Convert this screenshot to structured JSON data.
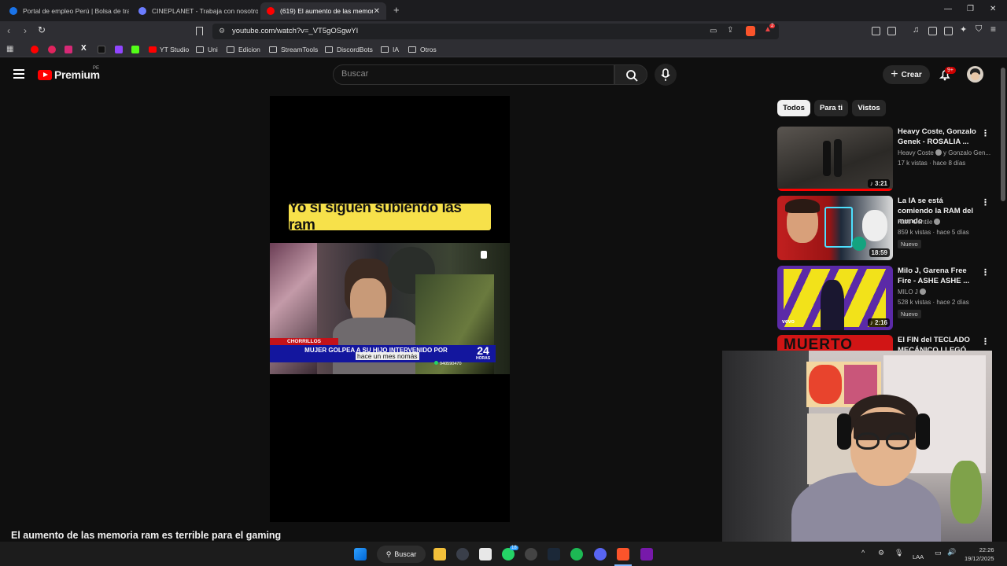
{
  "browser": {
    "tabs": [
      {
        "label": "Portal de empleo Perú | Bolsa de trab",
        "favicon_color": "#1a73e8"
      },
      {
        "label": "CINEPLANET - Trabaja con nosotros",
        "favicon_color": "#6b7cff"
      },
      {
        "label": "(619) El aumento de las memoria",
        "favicon_color": "#ff0000"
      }
    ],
    "new_tab_label": "+",
    "url": "youtube.com/watch?v=_VT5gOSgwYI",
    "shield_badge": "2",
    "bookmarks": [
      {
        "label": "YT Studio",
        "type": "link"
      },
      {
        "label": "Uni",
        "type": "folder"
      },
      {
        "label": "Edicion",
        "type": "folder"
      },
      {
        "label": "StreamTools",
        "type": "folder"
      },
      {
        "label": "DiscordBots",
        "type": "folder"
      },
      {
        "label": "IA",
        "type": "folder"
      },
      {
        "label": "Otros",
        "type": "folder"
      }
    ]
  },
  "youtube": {
    "logo_text": "Premium",
    "country": "PE",
    "search_placeholder": "Buscar",
    "create_label": "Crear",
    "notification_badge": "9+",
    "video": {
      "caption": "Yo si siguen subiendo las ram",
      "news_location": "CHORRILLOS",
      "news_headline": "MUJER GOLPEA A SU HIJO INTERVENIDO POR",
      "news_logo_top": "24",
      "news_logo_bottom": "HORAS",
      "news_phone": "940590470",
      "tooltip": "hace un mes nomás",
      "title": "El aumento de las memoria ram es terrible para el gaming"
    },
    "chips": [
      "Todos",
      "Para ti",
      "Vistos"
    ],
    "recommendations": [
      {
        "title": "Heavy Coste, Gonzalo Genek - ROSALIA ...",
        "channel": "Heavy Coste",
        "channel_extra": "y Gonzalo Gen...",
        "meta": "17 k vistas · hace 8 días",
        "duration": "3:21",
        "music": true,
        "new": "",
        "thumb_colors": [
          "#4a4642",
          "#2a2826"
        ]
      },
      {
        "title": "La IA se está comiendo la RAM del mundo",
        "channel": "Nate Gentile",
        "channel_extra": "",
        "meta": "859 k vistas · hace 5 días",
        "duration": "18:59",
        "music": false,
        "new": "Nuevo",
        "thumb_colors": [
          "#b21a1a",
          "#2aa7b8"
        ]
      },
      {
        "title": "Milo J, Garena Free Fire - ASHE ASHE ...",
        "channel": "MILO J",
        "channel_extra": "",
        "meta": "528 k vistas · hace 2 días",
        "duration": "2:16",
        "music": true,
        "new": "Nuevo",
        "thumb_colors": [
          "#f2e21a",
          "#5b2aa7"
        ]
      },
      {
        "title": "El FIN del TECLADO MECÁNICO LLEGÓ",
        "channel": "",
        "channel_extra": "",
        "meta": "",
        "duration": "",
        "music": false,
        "new": "",
        "thumb_colors": [
          "#d11515",
          "#1a1a1a"
        ],
        "thumb_text": "MUERTO"
      }
    ]
  },
  "taskbar": {
    "search_label": "Buscar",
    "keyboard": "LAA",
    "time": "22:26",
    "date": "19/12/2025",
    "whatsapp_badge": "18"
  }
}
